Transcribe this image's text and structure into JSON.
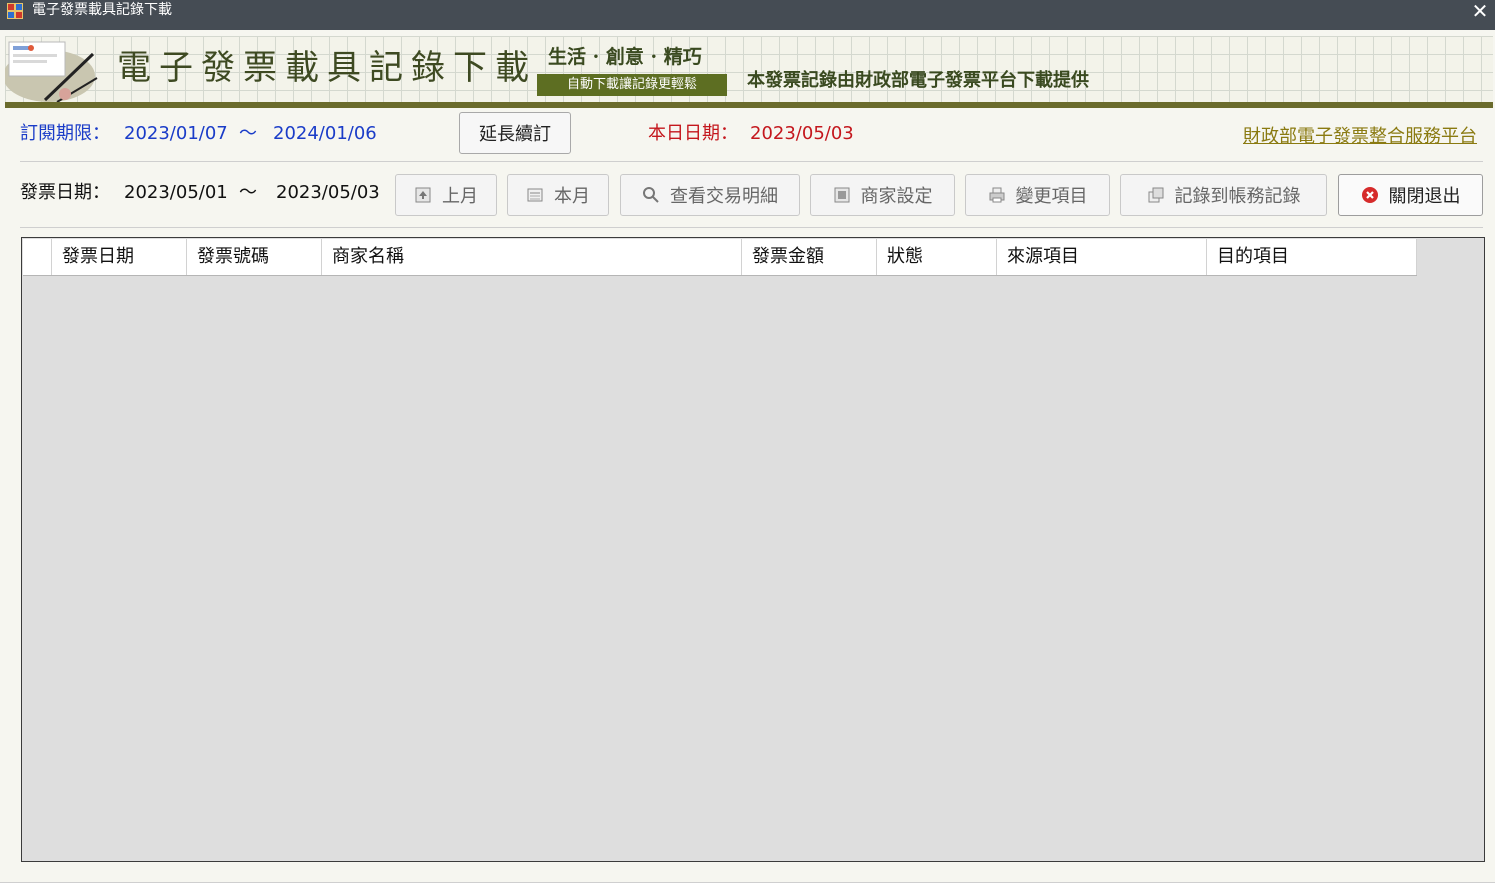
{
  "window": {
    "title": "電子發票載具記錄下載",
    "close_label": "✕"
  },
  "banner": {
    "title": "電子發票載具記錄下載",
    "slogan": "生活 · 創意 · 精巧",
    "badge": "自動下載讓記錄更輕鬆",
    "note": "本發票記錄由財政部電子發票平台下載提供"
  },
  "subscription": {
    "label": "訂閱期限：",
    "start": "2023/01/07",
    "sep": "～",
    "end": "2024/01/06",
    "extend_button": "延長續訂",
    "today_label": "本日日期：",
    "today": "2023/05/03",
    "platform_link": "財政部電子發票整合服務平台"
  },
  "filter": {
    "label": "發票日期：",
    "start": "2023/05/01",
    "sep": "～",
    "end": "2023/05/03"
  },
  "toolbar": {
    "prev_month": "上月",
    "this_month": "本月",
    "view_details": "查看交易明細",
    "merchant_settings": "商家設定",
    "change_items": "變更項目",
    "record_to_accounts": "記錄到帳務記錄",
    "close_exit": "關閉退出"
  },
  "table": {
    "columns": [
      "發票日期",
      "發票號碼",
      "商家名稱",
      "發票金額",
      "狀態",
      "來源項目",
      "目的項目"
    ],
    "rows": []
  },
  "colors": {
    "accent_blue": "#1a3cc8",
    "accent_red": "#c4171d",
    "banner_olive": "#6a6b2c",
    "link_gold": "#8a7a10"
  }
}
